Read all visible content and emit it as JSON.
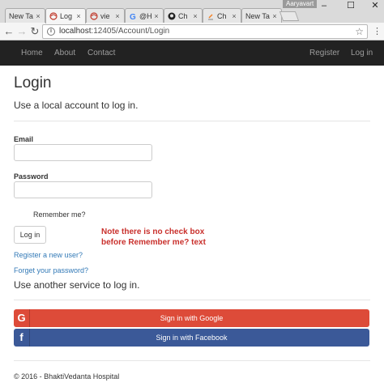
{
  "browser": {
    "profile_name": "Aaryavart",
    "tabs": [
      {
        "label": "New Ta",
        "icon": "blank-page-icon"
      },
      {
        "label": "Log",
        "icon": "web-icon",
        "active": true
      },
      {
        "label": "vie",
        "icon": "web-icon"
      },
      {
        "label": "@H",
        "icon": "google-icon"
      },
      {
        "label": "Ch",
        "icon": "github-icon"
      },
      {
        "label": "Ch",
        "icon": "stackoverflow-icon"
      },
      {
        "label": "New Ta",
        "icon": "blank-page-icon"
      }
    ],
    "url_host": "localhost",
    "url_rest": ":12405/Account/Login",
    "close_glyph": "×"
  },
  "nav": {
    "home": "Home",
    "about": "About",
    "contact": "Contact",
    "register": "Register",
    "login": "Log in"
  },
  "page": {
    "title": "Login",
    "subtitle": "Use a local account to log in.",
    "email_label": "Email",
    "email_value": "",
    "password_label": "Password",
    "password_value": "",
    "remember_label": "Remember me?",
    "login_button": "Log in",
    "note_line1": "Note there is no check box",
    "note_line2": "before Remember me? text",
    "register_link": "Register a new user?",
    "forgot_link": "Forget your password?",
    "another_service": "Use another service to log in.",
    "google_button": "Sign in with Google",
    "facebook_button": "Sign in with Facebook",
    "footer": "© 2016 - BhaktiVedanta Hospital"
  },
  "colors": {
    "navbar": "#222222",
    "google": "#dd4b39",
    "facebook": "#3b5998",
    "link": "#337ab7",
    "note": "#c9302c"
  }
}
